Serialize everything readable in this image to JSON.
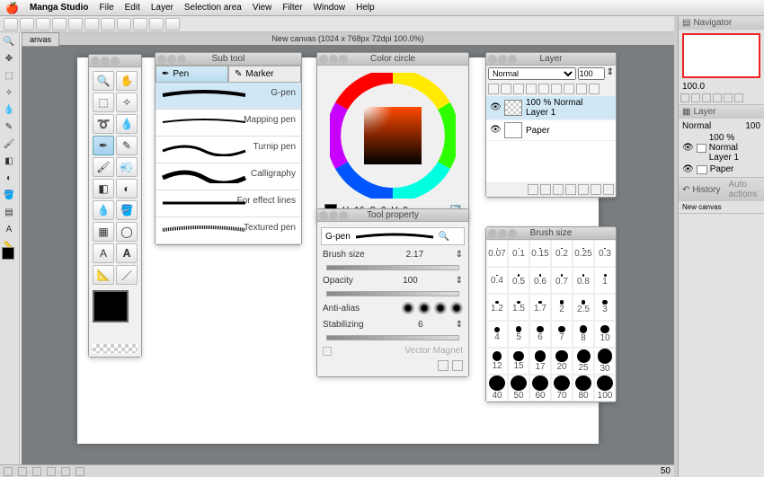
{
  "menubar": {
    "app": "Manga Studio",
    "items": [
      "File",
      "Edit",
      "Layer",
      "Selection area",
      "View",
      "Filter",
      "Window",
      "Help"
    ]
  },
  "canvas": {
    "tab": "anvas",
    "title": "New canvas (1024 x 768px 72dpi 100.0%)"
  },
  "subtool": {
    "title": "Sub tool",
    "tabs": [
      "Pen",
      "Marker"
    ],
    "active_tab": 0,
    "items": [
      "G-pen",
      "Mapping pen",
      "Turnip pen",
      "Calligraphy",
      "For effect lines",
      "Textured pen"
    ],
    "selected": 0
  },
  "colorcircle": {
    "title": "Color circle",
    "readout": {
      "h": "H",
      "hv": 16,
      "s": "S",
      "sv": 0,
      "v": "V",
      "vv": 0
    }
  },
  "toolprop": {
    "title": "Tool property",
    "name": "G-pen",
    "rows": {
      "brush_size_label": "Brush size",
      "brush_size_value": "2.17",
      "opacity_label": "Opacity",
      "opacity_value": "100",
      "antialias_label": "Anti-alias",
      "stabilizing_label": "Stabilizing",
      "stabilizing_value": "6",
      "vector_magnet_label": "Vector Magnet"
    }
  },
  "layer": {
    "title": "Layer",
    "blend_mode": "Normal",
    "opacity": "100",
    "layers": [
      {
        "opacity": "100 % Normal",
        "name": "Layer 1",
        "selected": true,
        "thumb": "checker"
      },
      {
        "opacity": "",
        "name": "Paper",
        "selected": false,
        "thumb": "paper"
      }
    ]
  },
  "brushsize": {
    "title": "Brush size",
    "sizes": [
      0.07,
      0.1,
      0.15,
      0.2,
      0.25,
      0.3,
      0.4,
      0.5,
      0.6,
      0.7,
      0.8,
      1,
      1.2,
      1.5,
      1.7,
      2,
      2.5,
      3,
      4,
      5,
      6,
      7,
      8,
      10,
      12,
      15,
      17,
      20,
      25,
      30,
      40,
      50,
      60,
      70,
      80,
      100
    ]
  },
  "rightdock": {
    "navigator": "Navigator",
    "zoom": "100.0",
    "layer": "Layer",
    "blend": "Normal",
    "opacity": "100",
    "layers": [
      {
        "label": "100 % Normal",
        "name": "Layer 1"
      },
      {
        "label": "",
        "name": "Paper"
      }
    ],
    "history": "History",
    "auto_actions": "Auto actions",
    "hist_item": "New canvas"
  },
  "statusbar": {
    "pagenum": "50"
  }
}
